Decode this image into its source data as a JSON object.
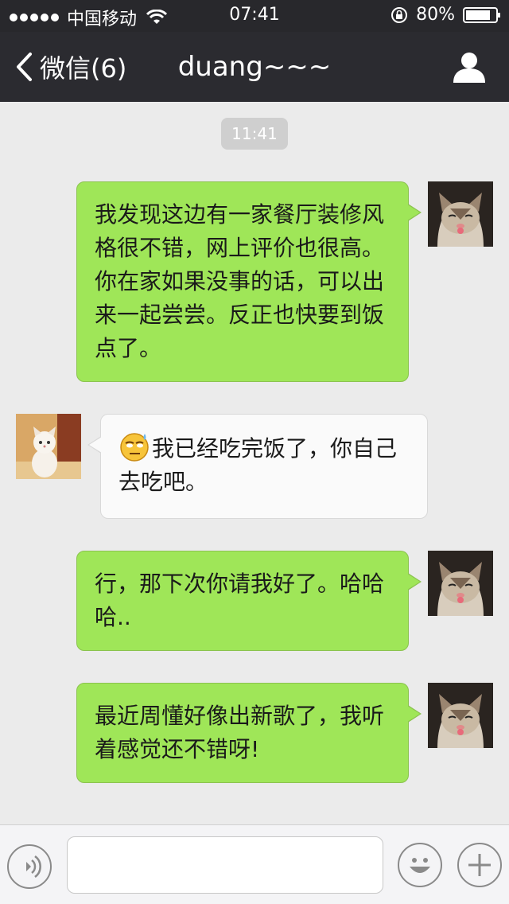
{
  "status_bar": {
    "carrier": "中国移动",
    "time": "07:41",
    "battery": "80%"
  },
  "nav": {
    "back_label": "微信(6)",
    "title": "duang~~~",
    "back_icon": "chevron-left-icon",
    "profile_icon": "person-icon"
  },
  "chat": {
    "timestamp": "11:41",
    "messages": [
      {
        "side": "out",
        "text": "我发现这边有一家餐厅装修风格很不错，网上评价也很高。你在家如果没事的话，可以出来一起尝尝。反正也快要到饭点了。"
      },
      {
        "side": "in",
        "emoji": "sweat-smile-emoji",
        "text": "我已经吃完饭了，你自己去吃吧。"
      },
      {
        "side": "out",
        "text": "行，那下次你请我好了。哈哈哈.."
      },
      {
        "side": "out",
        "text": "最近周懂好像出新歌了，我听着感觉还不错呀!"
      }
    ]
  },
  "input_bar": {
    "voice_icon": "voice-icon",
    "emoji_icon": "smiley-icon",
    "plus_icon": "plus-icon",
    "input_value": ""
  },
  "colors": {
    "nav_bg": "#2b2b30",
    "chat_bg": "#ebebeb",
    "outgoing_bubble": "#9fe658",
    "incoming_bubble": "#fafafa"
  }
}
